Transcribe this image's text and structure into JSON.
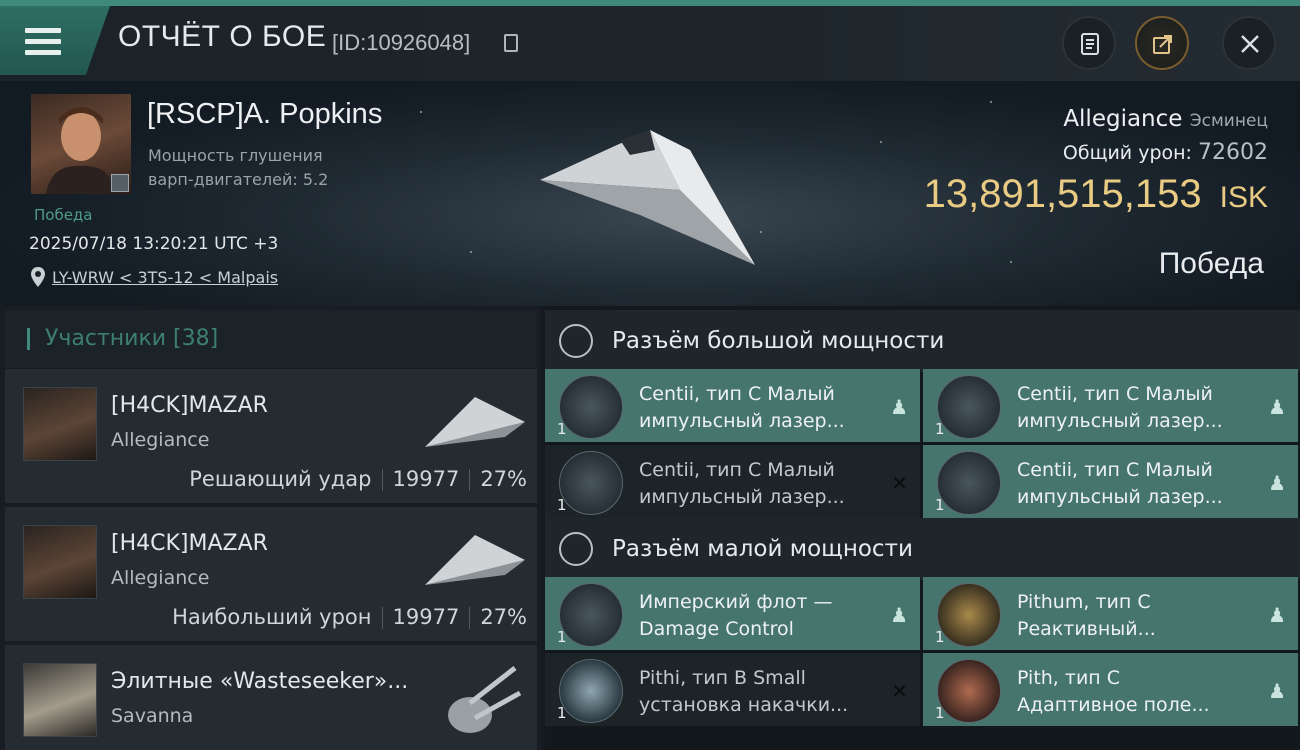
{
  "header": {
    "title": "ОТЧЁТ О БОЕ",
    "battle_id": "[ID:10926048]"
  },
  "pilot": {
    "name": "[RSCP]A. Popkins",
    "meta_line1": "Мощность глушения",
    "meta_line2": "варп-двигателей: 5.2",
    "tag": "Победа",
    "date": "2025/07/18 13:20:21 UTC +3",
    "location": "LY-WRW < 3TS-12 < Malpais"
  },
  "victim": {
    "ship": "Allegiance",
    "ship_class": "Эсминец",
    "damage_label": "Общий урон:",
    "damage_value": "72602",
    "isk_value": "13,891,515,153",
    "isk_unit": "ISK",
    "result": "Победа"
  },
  "participants": {
    "title": "Участники [38]",
    "rows": [
      {
        "name": "[H4CK]MAZAR",
        "corp": "Allegiance",
        "role": "Решающий удар",
        "damage": "19977",
        "percent": "27%"
      },
      {
        "name": "[H4CK]MAZAR",
        "corp": "Allegiance",
        "role": "Наибольший урон",
        "damage": "19977",
        "percent": "27%"
      },
      {
        "name": "Элитные «Wasteseeker»...",
        "corp": "Savanna"
      }
    ]
  },
  "high_slots": {
    "title": "Разъём большой мощности",
    "modules": [
      {
        "line1": "Centii, тип С Малый",
        "line2": "импульсный лазер...",
        "qty": "1",
        "state": "fitted"
      },
      {
        "line1": "Centii, тип С Малый",
        "line2": "импульсный лазер...",
        "qty": "1",
        "state": "fitted"
      },
      {
        "line1": "Centii, тип С Малый",
        "line2": "импульсный лазер...",
        "qty": "1",
        "state": "destroyed"
      },
      {
        "line1": "Centii, тип С Малый",
        "line2": "импульсный лазер...",
        "qty": "1",
        "state": "fitted"
      }
    ]
  },
  "low_slots": {
    "title": "Разъём малой мощности",
    "modules": [
      {
        "line1": "Имперский флот —",
        "line2": "Damage Control",
        "qty": "1",
        "state": "fitted"
      },
      {
        "line1": "Pithum, тип С",
        "line2": "Реактивный...",
        "qty": "1",
        "state": "fitted"
      },
      {
        "line1": "Pithi, тип B Small",
        "line2": "установка накачки...",
        "qty": "1",
        "state": "destroyed"
      },
      {
        "line1": "Pith, тип С",
        "line2": "Адаптивное поле...",
        "qty": "1",
        "state": "fitted"
      }
    ]
  },
  "colors": {
    "accent": "#3f8a7c",
    "fitted_bg": "#46756d",
    "isk": "#e9cb83"
  },
  "icons": [
    "menu-icon",
    "copy-icon",
    "clipboard-icon",
    "share-icon",
    "close-icon",
    "pin-icon",
    "pilot-icon",
    "x-icon",
    "shield-icon"
  ]
}
